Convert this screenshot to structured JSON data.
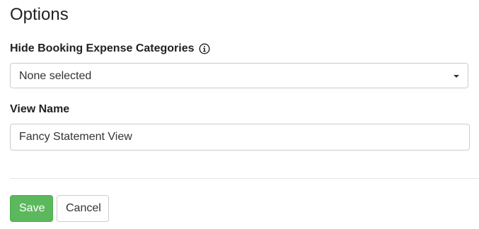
{
  "page": {
    "title": "Options"
  },
  "fields": {
    "expense_categories": {
      "label": "Hide Booking Expense Categories",
      "info_icon": "info-circle-icon",
      "selected": "None selected",
      "caret_icon": "caret-down-icon"
    },
    "view_name": {
      "label": "View Name",
      "value": "Fancy Statement View"
    }
  },
  "actions": {
    "save_label": "Save",
    "cancel_label": "Cancel"
  },
  "colors": {
    "save_button": "#5cb85c",
    "text": "#222222",
    "border": "#cccccc"
  }
}
